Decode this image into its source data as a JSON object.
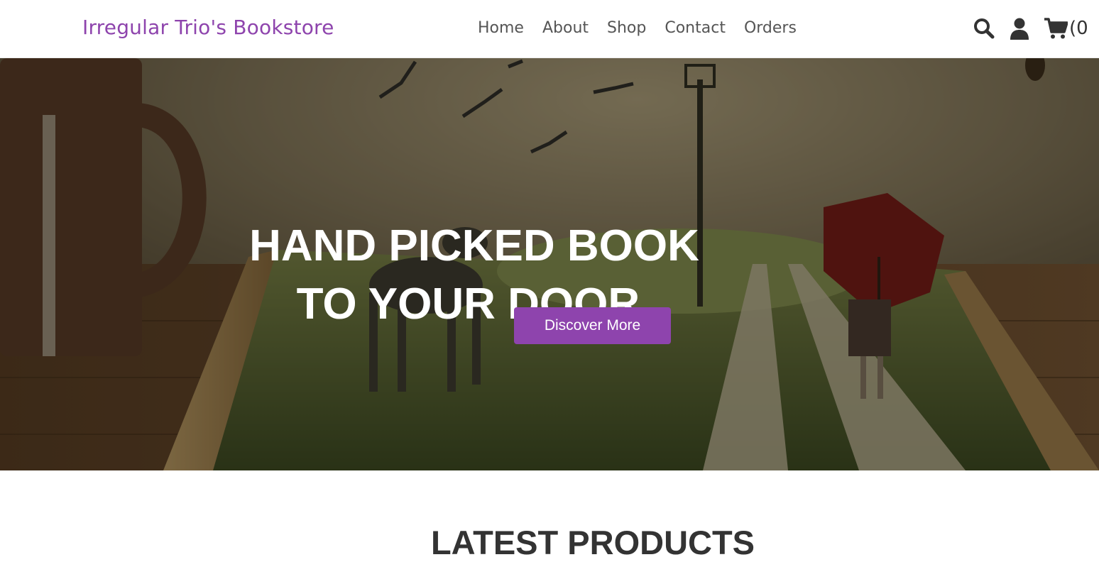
{
  "header": {
    "brand": "Irregular Trio's Bookstore",
    "nav": [
      "Home",
      "About",
      "Shop",
      "Contact",
      "Orders"
    ],
    "icons": [
      "search-icon",
      "user-icon",
      "cart-icon"
    ],
    "cart_count": "(0"
  },
  "hero": {
    "title_line1": "HAND PICKED BOOK",
    "title_line2": "TO YOUR DOOR.",
    "cta_label": "Discover More"
  },
  "latest": {
    "title": "LATEST PRODUCTS"
  },
  "colors": {
    "brand": "#8e44ad",
    "nav_text": "#555555",
    "heading": "#333333",
    "hero_text": "#ffffff"
  }
}
